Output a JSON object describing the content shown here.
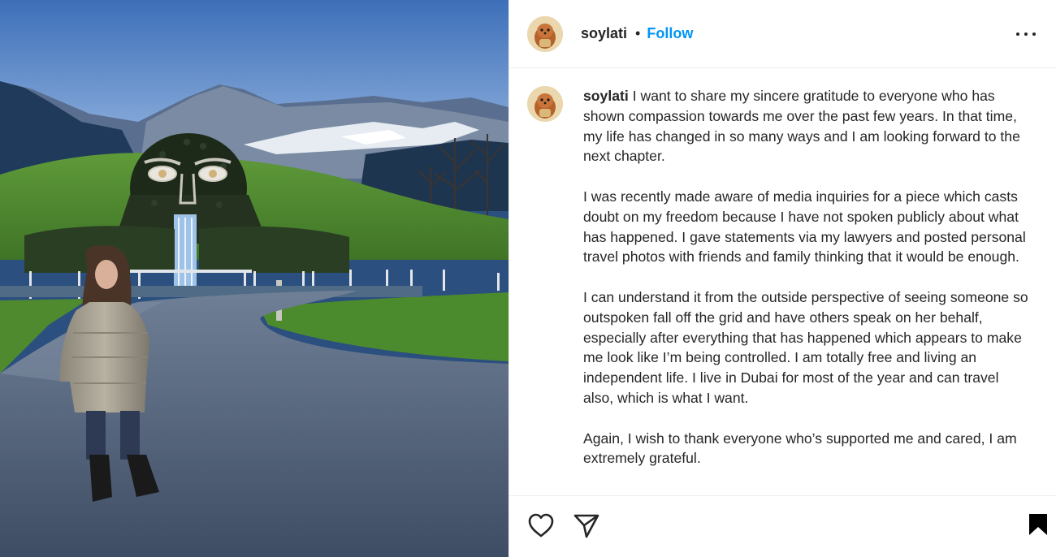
{
  "photo": {
    "icon": "post-photo",
    "alt_subject": "woman-standing-in-front-of-giant-hedge-face"
  },
  "header": {
    "username": "soylati",
    "separator": "•",
    "follow_label": "Follow",
    "more_icon": "more-horizontal-icon"
  },
  "caption": {
    "username": "soylati",
    "paragraphs": [
      "I want to share my sincere gratitude to everyone who has shown compassion towards me over the past few years. In that time, my life has changed in so many ways and I am looking forward to the next chapter.",
      "I was recently made aware of media inquiries for a piece which casts doubt on my freedom because I have not spoken publicly about what has happened. I gave statements via my lawyers and posted personal travel photos with friends and family thinking that it would be enough.",
      "I can understand it from the outside perspective of seeing someone so outspoken fall off the grid and have others speak on her behalf, especially after everything that has happened which appears to make me look like I’m being controlled. I am totally free and living an independent life. I live in Dubai for most of the year and can travel also, which is what I want.",
      "Again, I wish to thank everyone who’s supported me and cared, I am extremely grateful."
    ]
  },
  "actions": {
    "like_icon": "heart-icon",
    "share_icon": "paper-plane-icon",
    "save_icon": "bookmark-icon"
  },
  "colors": {
    "follow": "#0095f6",
    "text": "#262626",
    "divider": "#efefef"
  }
}
